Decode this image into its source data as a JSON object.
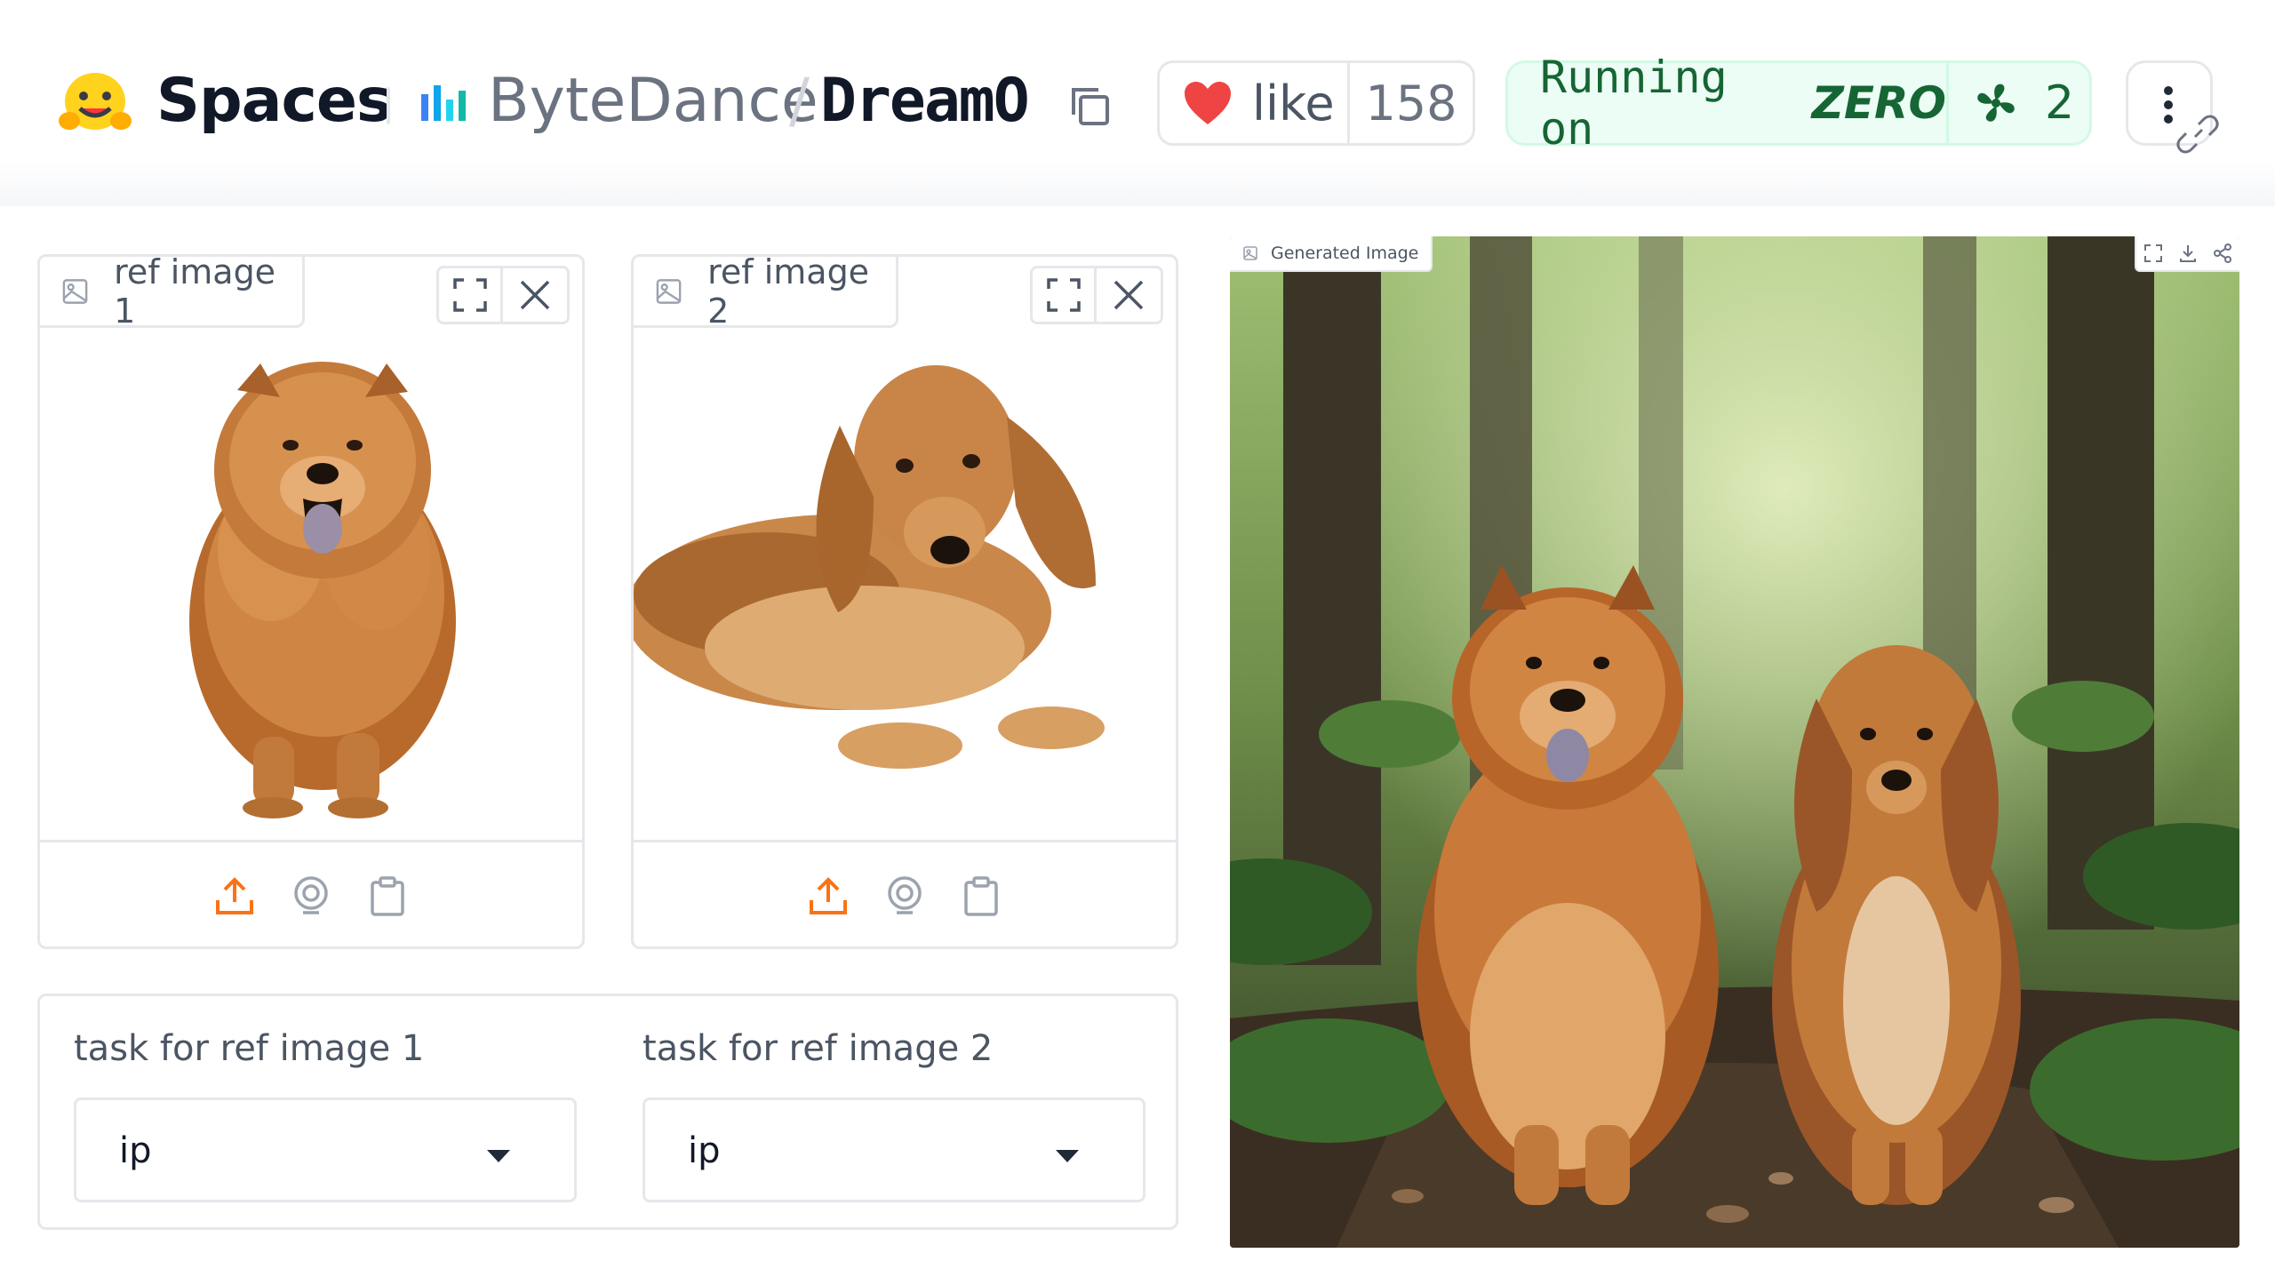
{
  "header": {
    "logo_icon": "hugging-face-icon",
    "brand": "Spaces",
    "org": "ByteDance",
    "separator": "/",
    "repo": "DreamO",
    "like_label": "like",
    "like_count": "158",
    "running_label": "Running on",
    "running_hardware": "ZERO",
    "running_count": "2"
  },
  "ref_images": [
    {
      "label": "ref image 1"
    },
    {
      "label": "ref image 2"
    }
  ],
  "tasks": [
    {
      "label": "task for ref image 1",
      "value": "ip"
    },
    {
      "label": "task for ref image 2",
      "value": "ip"
    }
  ],
  "output": {
    "label": "Generated Image"
  },
  "colors": {
    "accent": "#f97316",
    "heart": "#ef4444",
    "running_green": "#166534",
    "running_bg": "#ecfdf5"
  }
}
